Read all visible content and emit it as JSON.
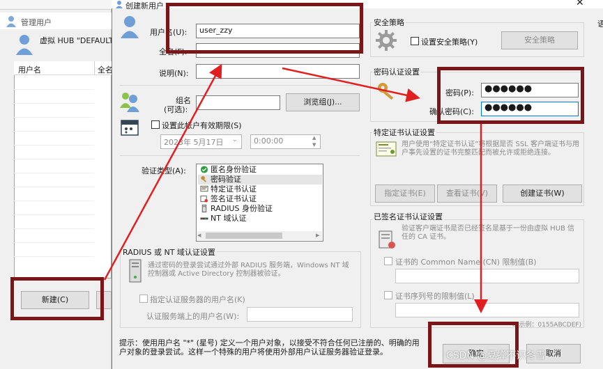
{
  "bg_window": {
    "title": "管理用户",
    "hub_text": "虚拟 HUB \"DEFAULT",
    "columns": [
      "用户名",
      "全名"
    ],
    "new_button": "新建(C)"
  },
  "dialog": {
    "title": "创建新用户",
    "close": "✕",
    "side_char": "语",
    "username_label": "用户名(U):",
    "username_value": "user_zzy",
    "fullname_label": "全名(F):",
    "fullname_value": "",
    "desc_label": "说明(N):",
    "desc_value": "",
    "group_label_1": "组名",
    "group_label_2": "(可选):",
    "group_value": "",
    "browse_group_button": "浏览组(J)...",
    "expire_checkbox": "设置此帐户有效期限(S)",
    "expire_date": "2023年 5月17日",
    "expire_time": "0:00:00",
    "auth_type_label": "验证类型(A):",
    "auth_types": [
      {
        "label": "匿名身份验证",
        "icon": "check-circle-icon",
        "selected": false
      },
      {
        "label": "密码验证",
        "icon": "key-icon",
        "selected": true
      },
      {
        "label": "特定证书认证",
        "icon": "certificate-icon",
        "selected": false
      },
      {
        "label": "签名证书认证",
        "icon": "signed-cert-icon",
        "selected": false
      },
      {
        "label": "RADIUS 身份验证",
        "icon": "server-icon",
        "selected": false
      },
      {
        "label": "NT 域认证",
        "icon": "network-icon",
        "selected": false
      }
    ],
    "radius": {
      "title": "RADIUS 或 NT 域认证设置",
      "desc": "通过密码的登录尝试通过外部 RADIUS 服务端，Windows NT 域控制器或 Active Directory 控制器被验证。",
      "checkbox": "指定认证服务器的用户名(K)",
      "server_user_label": "认证服务端上的用户名(W):"
    },
    "security": {
      "title": "安全策略",
      "checkbox": "设置安全策略(Y)",
      "button": "安全策略"
    },
    "password": {
      "title": "密码认证设置",
      "pw_label": "密码(P):",
      "pw_value": "●●●●●●",
      "confirm_label": "确认密码(C):",
      "confirm_value": "●●●●●●"
    },
    "cert": {
      "title": "特定证书认证设置",
      "desc": "用户使用“特定证书认证”将根据是否 SSL 客户端证书与用户事先设置的证书完整匹配而被允许或拒绝连接。",
      "specify_button": "指定证书(E)",
      "view_button": "查看证书(V)",
      "create_button": "创建证书(W)"
    },
    "signed": {
      "title": "已签名证书认证设置",
      "desc": "验证客户端证书是否已经签名是基于一份由虚拟 HUB 信任的 CA 证书。",
      "cn_checkbox": "证书的 Common Name (CN) 限制值(B)",
      "serial_checkbox": "证书序列号的限制值(L)",
      "example": "※ 示例：0155ABCDEF)"
    },
    "hint": "提示：使用用户名 \"*\" (星号) 定义一个用户对象，以接受不符合任何已注册的、明确的用户对象的登录尝试。这样一个特殊的用户将使用外部用户认证服务器验证登录。",
    "ok_button": "确定",
    "cancel_button": "取消"
  },
  "watermark": "CSDN @夏蝉不识冬雪",
  "colors": {
    "annotation": "#7a1518",
    "arrow": "#e02020",
    "focus_border": "#0078d7"
  }
}
